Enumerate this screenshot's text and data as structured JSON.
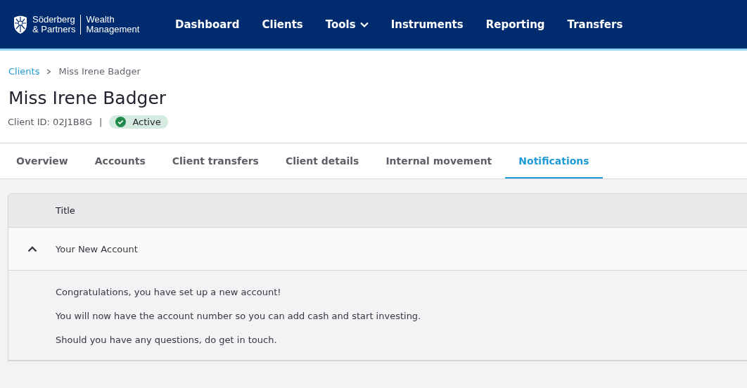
{
  "header": {
    "logo": {
      "name_line_1": "Söderberg",
      "name_line_2": "& Partners",
      "product_line_1": "Wealth",
      "product_line_2": "Management"
    },
    "nav": [
      {
        "label": "Dashboard",
        "kind": "link"
      },
      {
        "label": "Clients",
        "kind": "link"
      },
      {
        "label": "Tools",
        "kind": "dropdown"
      },
      {
        "label": "Instruments",
        "kind": "link"
      },
      {
        "label": "Reporting",
        "kind": "link"
      },
      {
        "label": "Transfers",
        "kind": "link"
      }
    ]
  },
  "breadcrumb": [
    {
      "label": "Clients",
      "kind": "link"
    },
    {
      "label": "Miss Irene Badger",
      "kind": "current"
    }
  ],
  "client": {
    "name": "Miss Irene Badger",
    "client_id": "Client ID: 02J1B8G",
    "separator": "|",
    "status": "Active"
  },
  "tabs": [
    {
      "label": "Overview",
      "selected": false
    },
    {
      "label": "Accounts",
      "selected": false
    },
    {
      "label": "Client transfers",
      "selected": false
    },
    {
      "label": "Client details",
      "selected": false
    },
    {
      "label": "Internal movement",
      "selected": false
    },
    {
      "label": "Notifications",
      "selected": true
    }
  ],
  "table": {
    "columns": [
      "Title"
    ],
    "rows": [
      {
        "title": "Your New Account",
        "expanded": true,
        "body": [
          "Congratulations, you have set up a new account!",
          "You will now have the account number so you can add cash and start investing.",
          "Should you have any questions, do get in touch."
        ]
      }
    ]
  }
}
